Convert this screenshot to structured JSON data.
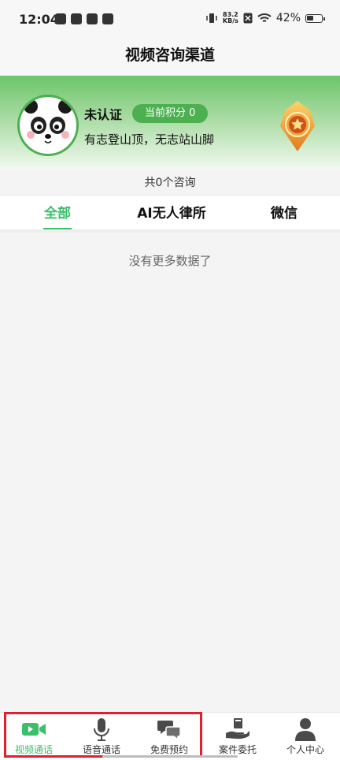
{
  "status_bar": {
    "time": "12:04",
    "net_speed_value": "83.2",
    "net_speed_unit": "KB/s",
    "battery": "42%"
  },
  "header": {
    "title": "视频咨询渠道"
  },
  "profile": {
    "name": "未认证",
    "points_label": "当前积分 0",
    "motto": "有志登山顶，无志站山脚",
    "accent_color": "#4caf50"
  },
  "summary": {
    "count_text": "共0个咨询"
  },
  "tabs": [
    {
      "label": "全部",
      "active": true
    },
    {
      "label": "AI无人律所",
      "active": false
    },
    {
      "label": "微信",
      "active": false
    }
  ],
  "empty_message": "没有更多数据了",
  "bottom_nav": [
    {
      "label": "视频通话",
      "icon": "video-camera-icon",
      "active": true
    },
    {
      "label": "语音通话",
      "icon": "microphone-icon",
      "active": false
    },
    {
      "label": "免费预约",
      "icon": "chat-bubbles-icon",
      "active": false
    },
    {
      "label": "案件委托",
      "icon": "hand-document-icon",
      "active": false
    },
    {
      "label": "个人中心",
      "icon": "person-icon",
      "active": false
    }
  ],
  "colors": {
    "brand_green": "#3bbf6a",
    "highlight_red": "#e0202a"
  }
}
